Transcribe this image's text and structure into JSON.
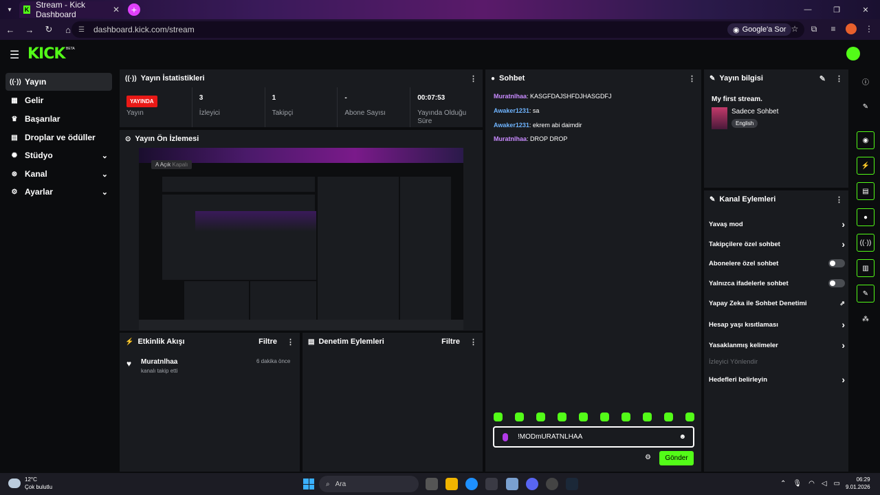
{
  "browser": {
    "tab_title": "Stream - Kick Dashboard",
    "url": "dashboard.kick.com/stream",
    "google_ask": "Google'a Sor"
  },
  "header": {
    "logo": "KICK",
    "beta": "BETA"
  },
  "sidebar": {
    "items": [
      {
        "label": "Yayın",
        "icon": "broadcast-icon"
      },
      {
        "label": "Gelir",
        "icon": "revenue-icon"
      },
      {
        "label": "Başarılar",
        "icon": "trophy-icon"
      },
      {
        "label": "Droplar ve ödüller",
        "icon": "gift-icon"
      },
      {
        "label": "Stüdyo",
        "icon": "studio-icon"
      },
      {
        "label": "Kanal",
        "icon": "channel-icon"
      },
      {
        "label": "Ayarlar",
        "icon": "gear-icon"
      }
    ]
  },
  "stats": {
    "title": "Yayın İstatistikleri",
    "items": [
      {
        "value": "YAYINDA",
        "label": "Yayın"
      },
      {
        "value": "3",
        "label": "İzleyici"
      },
      {
        "value": "1",
        "label": "Takipçi"
      },
      {
        "value": "-",
        "label": "Abone Sayısı"
      },
      {
        "value": "00:07:53",
        "label": "Yayında Olduğu Süre"
      }
    ]
  },
  "preview": {
    "title": "Yayın Ön İzlemesi",
    "tooltip_key": "A",
    "tooltip_text": "Açık",
    "tooltip_dim": "Kapalı"
  },
  "events": {
    "title": "Etkinlik Akışı",
    "filter": "Filtre",
    "items": [
      {
        "user": "Muratnlhaa",
        "action": "kanalı takip etti",
        "time": "6 dakika önce"
      }
    ]
  },
  "moderation": {
    "title": "Denetim Eylemleri",
    "filter": "Filtre"
  },
  "chat": {
    "title": "Sohbet",
    "messages": [
      {
        "user": "Muratnlhaa",
        "text": "KASGFDAJSHFDJHASGDFJ"
      },
      {
        "user": "Awaker1231",
        "text": "sa"
      },
      {
        "user": "Awaker1231",
        "text": "ekrem abi daimdir"
      },
      {
        "user": "Muratnlhaa",
        "text": "DROP DROP"
      }
    ],
    "input_value": "!MODmURATNLHAA",
    "send": "Gönder"
  },
  "stream_info": {
    "title": "Yayın bilgisi",
    "stream_title": "My first stream.",
    "category": "Sadece Sohbet",
    "language": "English"
  },
  "channel_actions": {
    "title": "Kanal Eylemleri",
    "items": [
      {
        "label": "Yavaş mod",
        "type": "arrow"
      },
      {
        "label": "Takipçilere özel sohbet",
        "type": "arrow"
      },
      {
        "label": "Abonelere özel sohbet",
        "type": "toggle"
      },
      {
        "label": "Yalnızca ifadelerle sohbet",
        "type": "toggle"
      },
      {
        "label": "Yapay Zeka ile Sohbet Denetimi",
        "type": "external"
      },
      {
        "label": "Hesap yaşı kısıtlaması",
        "type": "arrow"
      },
      {
        "label": "Yasaklanmış kelimeler",
        "type": "arrow"
      },
      {
        "label": "İzleyici Yönlendir",
        "type": "disabled"
      },
      {
        "label": "Hedefleri belirleyin",
        "type": "arrow"
      }
    ]
  },
  "taskbar": {
    "temp": "12°C",
    "weather": "Çok bulutlu",
    "search": "Ara",
    "time": "06:29",
    "date": "9.01.2026"
  },
  "colors": {
    "accent": "#53fc18",
    "live": "#e91916",
    "panel": "#191b1f"
  }
}
